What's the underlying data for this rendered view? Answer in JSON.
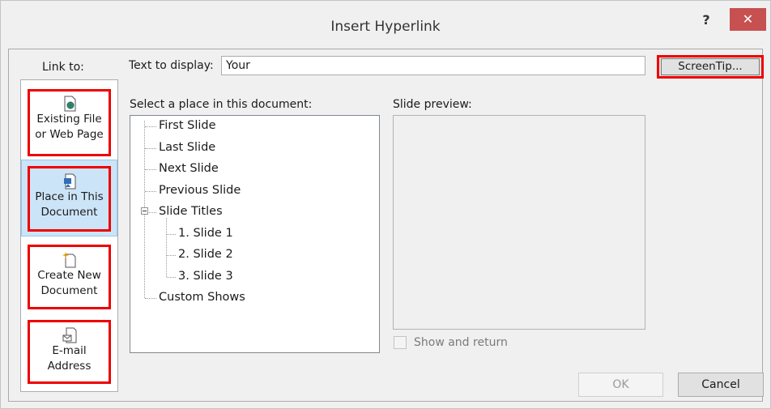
{
  "dialog": {
    "title": "Insert Hyperlink",
    "help_label": "?",
    "close_label": "✕"
  },
  "link_to": {
    "label": "Link to:",
    "options": [
      {
        "line1": "Existing File",
        "line2": "or Web Page",
        "icon": "existing-file-icon",
        "selected": false
      },
      {
        "line1": "Place in This",
        "line2": "Document",
        "icon": "place-in-document-icon",
        "selected": true
      },
      {
        "line1": "Create New",
        "line2": "Document",
        "icon": "new-document-icon",
        "selected": false
      },
      {
        "line1": "E-mail",
        "line2": "Address",
        "icon": "email-address-icon",
        "selected": false
      }
    ]
  },
  "text_to_display": {
    "label": "Text to display:",
    "value": "Your"
  },
  "screentip_label": "ScreenTip...",
  "place_section": {
    "label": "Select a place in this document:",
    "items": [
      "First Slide",
      "Last Slide",
      "Next Slide",
      "Previous Slide",
      "Slide Titles",
      "1. Slide 1",
      "2. Slide 2",
      "3. Slide 3",
      "Custom Shows"
    ]
  },
  "preview": {
    "label": "Slide preview:"
  },
  "show_and_return": {
    "label": "Show and return",
    "checked": false
  },
  "buttons": {
    "ok": "OK",
    "cancel": "Cancel"
  },
  "colors": {
    "highlight": "#ee0000",
    "selected_bg": "#cce4f7",
    "close_bg": "#c75050"
  }
}
